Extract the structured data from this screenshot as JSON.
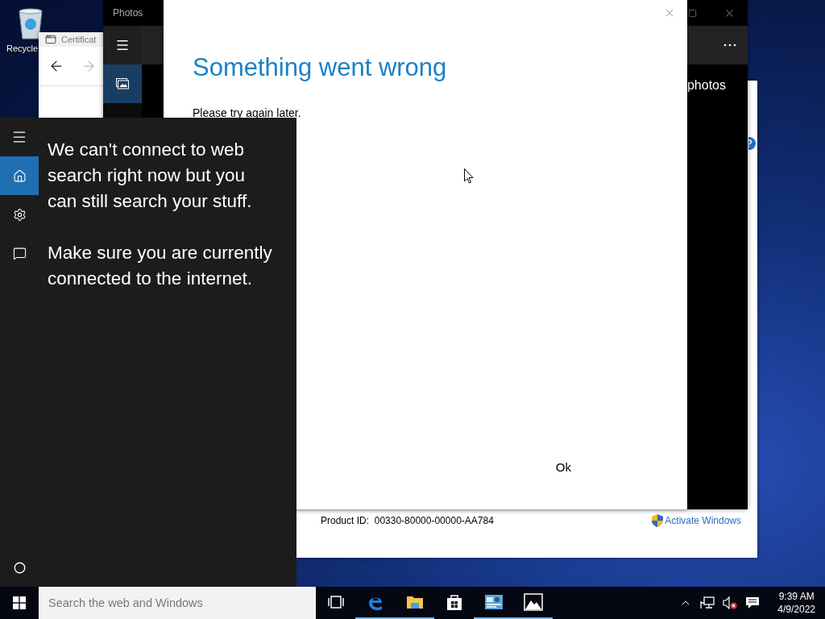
{
  "desktop": {
    "icons": [
      {
        "label": "Recycle"
      }
    ]
  },
  "certificate_window": {
    "title": "Certificat"
  },
  "system_window": {
    "product_id_label": "Product ID:",
    "product_id": "00330-80000-00000-AA784",
    "activate_link": "Activate Windows"
  },
  "photos_window": {
    "title": "Photos",
    "heading": "photos",
    "nav": [
      {
        "kind": "menu",
        "selected": false
      },
      {
        "kind": "collection",
        "selected": true
      }
    ]
  },
  "dialog": {
    "title": "Something went wrong",
    "message": "Please try again later.",
    "ok_button": "Ok"
  },
  "cortana": {
    "nav": [
      {
        "kind": "menu",
        "selected": false
      },
      {
        "kind": "home",
        "selected": true
      },
      {
        "kind": "settings",
        "selected": false
      },
      {
        "kind": "feedback",
        "selected": false
      }
    ],
    "messages": [
      "We can't connect to web search right now but you can still search your stuff.",
      "Make sure you are currently connected to the internet."
    ]
  },
  "taskbar": {
    "search": {
      "placeholder": "Search the web and Windows"
    },
    "apps": [
      {
        "kind": "taskview",
        "running": false
      },
      {
        "kind": "edge",
        "running": true
      },
      {
        "kind": "explorer",
        "running": true
      },
      {
        "kind": "store",
        "running": false
      },
      {
        "kind": "control",
        "running": true
      },
      {
        "kind": "photos",
        "running": true
      }
    ],
    "time": "9:39 AM",
    "date": "4/9/2022"
  }
}
